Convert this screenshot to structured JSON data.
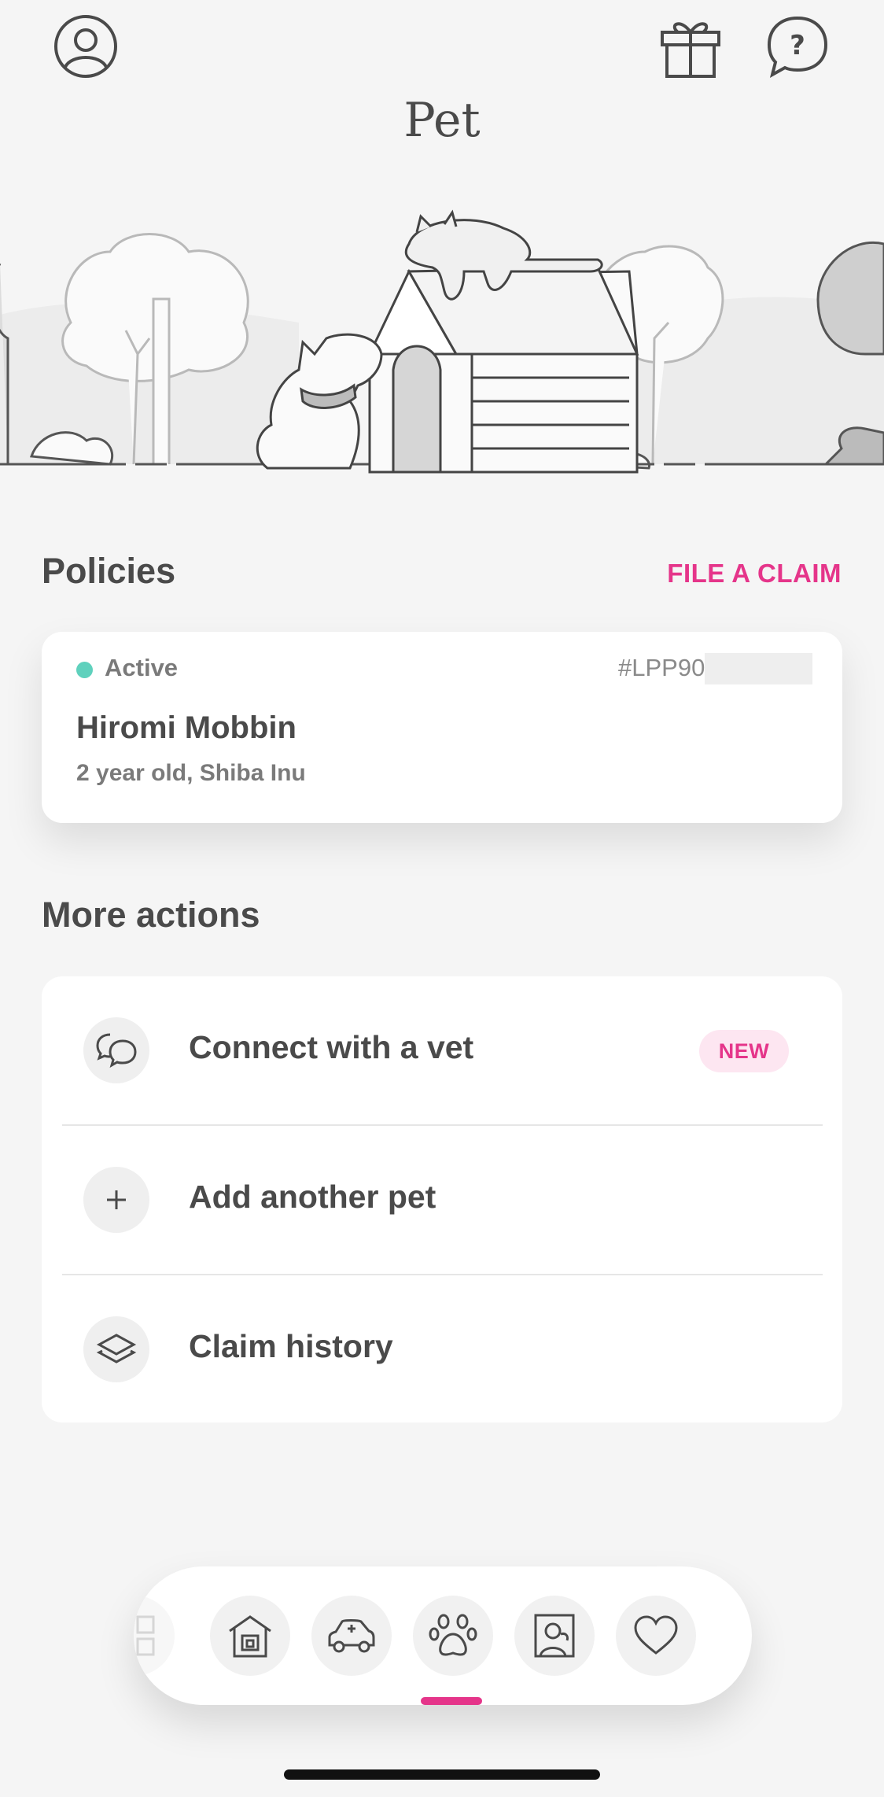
{
  "header": {
    "title": "Pet",
    "profile_icon": "profile-icon",
    "gift_icon": "gift-icon",
    "help_icon": "help-icon"
  },
  "policies": {
    "section_title": "Policies",
    "file_claim_label": "FILE A CLAIM",
    "card": {
      "status": "Active",
      "status_color": "#5fd1bd",
      "policy_number": "#LPP90",
      "pet_name": "Hiromi Mobbin",
      "pet_description": "2 year old, Shiba Inu"
    }
  },
  "more_actions": {
    "section_title": "More actions",
    "items": [
      {
        "label": "Connect with a vet",
        "icon": "chat-bubbles-icon",
        "badge": "NEW"
      },
      {
        "label": "Add another pet",
        "icon": "plus-icon"
      },
      {
        "label": "Claim history",
        "icon": "layers-icon"
      }
    ]
  },
  "bottom_nav": {
    "items": [
      {
        "icon": "grid-icon"
      },
      {
        "icon": "house-icon"
      },
      {
        "icon": "car-icon"
      },
      {
        "icon": "paw-icon",
        "active": true
      },
      {
        "icon": "portrait-icon"
      },
      {
        "icon": "heart-icon"
      }
    ]
  },
  "colors": {
    "accent": "#e5358a",
    "active_status": "#5fd1bd",
    "background": "#f5f5f5"
  }
}
